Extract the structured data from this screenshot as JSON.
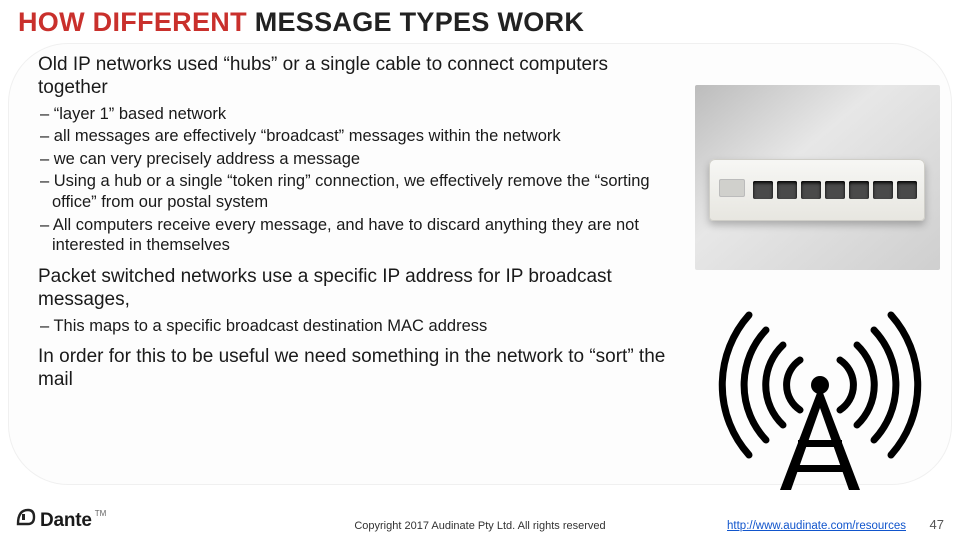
{
  "title": {
    "part1": "HOW DIFFERENT",
    "part2": " MESSAGE TYPES WORK"
  },
  "body": {
    "p1": "Old IP networks used “hubs” or a single cable to connect computers together",
    "b1": "“layer 1” based network",
    "b2": "all messages are effectively “broadcast” messages within the network",
    "b3": "we can very precisely address a message",
    "b4": "Using a hub or a single “token ring” connection, we effectively remove the “sorting office” from our postal system",
    "b5": "All computers receive every message, and have to discard anything they are not interested in themselves",
    "p2": "Packet switched networks use a specific IP address for IP broadcast messages,",
    "b6": "This maps to a specific broadcast destination MAC address",
    "p3": "In order for this to be useful we need something in the network to “sort” the mail"
  },
  "footer": {
    "logo_text": "Dante",
    "logo_tm": "TM",
    "copyright": "Copyright 2017 Audinate Pty Ltd. All rights reserved",
    "link": "http://www.audinate.com/resources",
    "page": "47"
  }
}
